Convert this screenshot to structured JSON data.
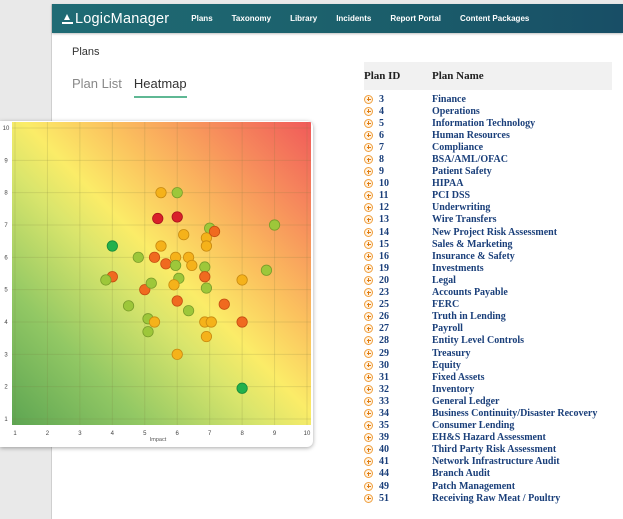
{
  "navbar": {
    "brand": "LogicManager",
    "items": [
      "Plans",
      "Taxonomy",
      "Library",
      "Incidents",
      "Report Portal",
      "Content Packages"
    ]
  },
  "breadcrumb": "Plans",
  "tabs": [
    {
      "label": "Plan List",
      "active": false
    },
    {
      "label": "Heatmap",
      "active": true
    }
  ],
  "plan_table": {
    "headers": [
      "Plan ID",
      "Plan Name"
    ],
    "rows": [
      {
        "id": "3",
        "name": "Finance"
      },
      {
        "id": "4",
        "name": "Operations"
      },
      {
        "id": "5",
        "name": "Information Technology"
      },
      {
        "id": "6",
        "name": "Human Resources"
      },
      {
        "id": "7",
        "name": "Compliance"
      },
      {
        "id": "8",
        "name": "BSA/AML/OFAC"
      },
      {
        "id": "9",
        "name": "Patient Safety"
      },
      {
        "id": "10",
        "name": "HIPAA"
      },
      {
        "id": "11",
        "name": "PCI DSS"
      },
      {
        "id": "12",
        "name": "Underwriting"
      },
      {
        "id": "13",
        "name": "Wire Transfers"
      },
      {
        "id": "14",
        "name": "New Project Risk Assessment"
      },
      {
        "id": "15",
        "name": "Sales & Marketing"
      },
      {
        "id": "16",
        "name": "Insurance & Safety"
      },
      {
        "id": "19",
        "name": "Investments"
      },
      {
        "id": "20",
        "name": "Legal"
      },
      {
        "id": "23",
        "name": "Accounts Payable"
      },
      {
        "id": "25",
        "name": "FERC"
      },
      {
        "id": "26",
        "name": "Truth in Lending"
      },
      {
        "id": "27",
        "name": "Payroll"
      },
      {
        "id": "28",
        "name": "Entity Level Controls"
      },
      {
        "id": "29",
        "name": "Treasury"
      },
      {
        "id": "30",
        "name": "Equity"
      },
      {
        "id": "31",
        "name": "Fixed Assets"
      },
      {
        "id": "32",
        "name": "Inventory"
      },
      {
        "id": "33",
        "name": "General Ledger"
      },
      {
        "id": "34",
        "name": "Business Continuity/Disaster Recovery"
      },
      {
        "id": "35",
        "name": "Consumer Lending"
      },
      {
        "id": "39",
        "name": "EH&S Hazard Assessment"
      },
      {
        "id": "40",
        "name": "Third Party Risk Assessment"
      },
      {
        "id": "41",
        "name": "Network Infrastructure Audit"
      },
      {
        "id": "44",
        "name": "Branch Audit"
      },
      {
        "id": "49",
        "name": "Patch Management"
      },
      {
        "id": "51",
        "name": "Receiving Raw Meat / Poultry"
      }
    ]
  },
  "colors": {
    "navbar": "#1b5f6b",
    "tab_underline": "#5fb894",
    "plan_link": "#1a3f7a",
    "expand_icon": "#f0a040"
  },
  "chart_data": {
    "type": "scatter",
    "title": "",
    "xlabel": "Impact",
    "ylabel": "",
    "xlim": [
      1,
      10
    ],
    "ylim": [
      1,
      10
    ],
    "xticks": [
      1,
      2,
      3,
      4,
      5,
      6,
      7,
      8,
      9,
      10
    ],
    "yticks": [
      1,
      2,
      3,
      4,
      5,
      6,
      7,
      8,
      9,
      10
    ],
    "grid": true,
    "background": "diagonal risk gradient: green (low impact/likelihood) to yellow to red (high impact/likelihood)",
    "risk_colors": {
      "low": "#22b14c",
      "low-medium": "#9dc73a",
      "medium": "#f5b21a",
      "high": "#f06a1f",
      "critical": "#d9202a"
    },
    "points": [
      {
        "x": 4.0,
        "y": 6.35,
        "level": "low"
      },
      {
        "x": 4.0,
        "y": 5.4,
        "level": "high"
      },
      {
        "x": 3.8,
        "y": 5.3,
        "level": "low-medium"
      },
      {
        "x": 4.8,
        "y": 6.0,
        "level": "low-medium"
      },
      {
        "x": 4.5,
        "y": 4.5,
        "level": "low-medium"
      },
      {
        "x": 5.0,
        "y": 5.0,
        "level": "high"
      },
      {
        "x": 5.2,
        "y": 5.2,
        "level": "low-medium"
      },
      {
        "x": 5.4,
        "y": 7.2,
        "level": "critical"
      },
      {
        "x": 6.0,
        "y": 7.25,
        "level": "critical"
      },
      {
        "x": 5.5,
        "y": 8.0,
        "level": "medium"
      },
      {
        "x": 6.0,
        "y": 8.0,
        "level": "low-medium"
      },
      {
        "x": 6.2,
        "y": 6.7,
        "level": "medium"
      },
      {
        "x": 5.5,
        "y": 6.35,
        "level": "medium"
      },
      {
        "x": 5.3,
        "y": 6.0,
        "level": "high"
      },
      {
        "x": 5.65,
        "y": 5.8,
        "level": "high"
      },
      {
        "x": 5.95,
        "y": 6.0,
        "level": "medium"
      },
      {
        "x": 5.95,
        "y": 5.75,
        "level": "low-medium"
      },
      {
        "x": 6.35,
        "y": 6.0,
        "level": "medium"
      },
      {
        "x": 6.45,
        "y": 5.75,
        "level": "medium"
      },
      {
        "x": 7.0,
        "y": 6.9,
        "level": "low-medium"
      },
      {
        "x": 6.9,
        "y": 6.6,
        "level": "medium"
      },
      {
        "x": 7.15,
        "y": 6.8,
        "level": "high"
      },
      {
        "x": 6.9,
        "y": 6.35,
        "level": "medium"
      },
      {
        "x": 6.85,
        "y": 5.7,
        "level": "low-medium"
      },
      {
        "x": 6.85,
        "y": 5.4,
        "level": "high"
      },
      {
        "x": 6.9,
        "y": 5.05,
        "level": "low-medium"
      },
      {
        "x": 6.05,
        "y": 5.35,
        "level": "low-medium"
      },
      {
        "x": 5.9,
        "y": 5.15,
        "level": "medium"
      },
      {
        "x": 6.0,
        "y": 4.65,
        "level": "high"
      },
      {
        "x": 6.35,
        "y": 4.35,
        "level": "low-medium"
      },
      {
        "x": 5.1,
        "y": 4.1,
        "level": "low-medium"
      },
      {
        "x": 5.3,
        "y": 4.0,
        "level": "medium"
      },
      {
        "x": 5.1,
        "y": 3.7,
        "level": "low-medium"
      },
      {
        "x": 6.85,
        "y": 4.0,
        "level": "medium"
      },
      {
        "x": 7.05,
        "y": 4.0,
        "level": "medium"
      },
      {
        "x": 6.9,
        "y": 3.55,
        "level": "medium"
      },
      {
        "x": 6.0,
        "y": 3.0,
        "level": "medium"
      },
      {
        "x": 7.45,
        "y": 4.55,
        "level": "high"
      },
      {
        "x": 8.0,
        "y": 5.3,
        "level": "medium"
      },
      {
        "x": 8.75,
        "y": 5.6,
        "level": "low-medium"
      },
      {
        "x": 9.0,
        "y": 7.0,
        "level": "low-medium"
      },
      {
        "x": 8.0,
        "y": 4.0,
        "level": "high"
      },
      {
        "x": 8.0,
        "y": 1.95,
        "level": "low"
      }
    ]
  }
}
